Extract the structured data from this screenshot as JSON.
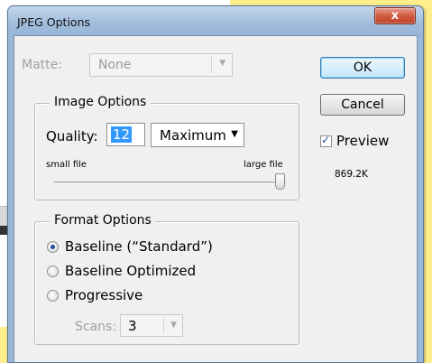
{
  "window": {
    "title": "JPEG Options",
    "close_symbol": "x"
  },
  "matte": {
    "label": "Matte:",
    "value": "None"
  },
  "image_options": {
    "legend": "Image Options",
    "quality_label": "Quality:",
    "quality_value": "12",
    "quality_preset": "Maximum",
    "small_file_label": "small file",
    "large_file_label": "large file",
    "slider_level_fraction": 1.0
  },
  "format_options": {
    "legend": "Format Options",
    "options": [
      {
        "label": "Baseline (“Standard”)",
        "checked": true
      },
      {
        "label": "Baseline Optimized",
        "checked": false
      },
      {
        "label": "Progressive",
        "checked": false
      }
    ],
    "scans_label": "Scans:",
    "scans_value": "3"
  },
  "buttons": {
    "ok": "OK",
    "cancel": "Cancel"
  },
  "preview": {
    "label": "Preview",
    "checked": true,
    "file_size": "869.2K"
  },
  "colors": {
    "title_bar": "#9fbbdb",
    "close_button": "#cf5a40",
    "selection": "#3399ff",
    "background_yellow": "#ffef8a"
  }
}
